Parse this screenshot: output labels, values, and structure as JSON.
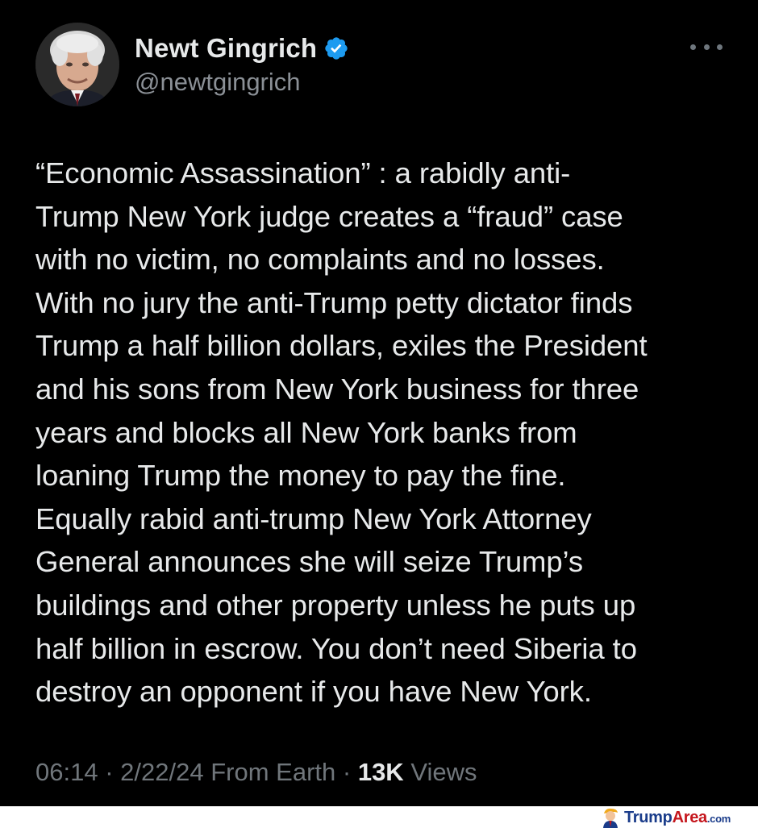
{
  "author": {
    "display_name": "Newt Gingrich",
    "handle": "@newtgingrich",
    "verified": true,
    "verified_icon": "verified-badge-icon",
    "avatar": "profile-photo"
  },
  "header": {
    "more_icon": "more-horizontal-icon"
  },
  "tweet": {
    "lines": [
      "“Economic Assassination” : a rabidly anti-",
      "Trump New York judge creates a “fraud” case",
      "with no victim, no complaints and no losses.",
      "With no jury the anti-Trump petty dictator finds",
      "Trump a half billion dollars, exiles the President",
      "and his sons from New York business for three",
      "years and blocks all New York banks from",
      "loaning Trump the money to pay the fine.",
      "Equally rabid anti-trump New York Attorney",
      "General announces she will seize Trump’s",
      "buildings and other property unless he puts up",
      "half billion in escrow. You don’t need Siberia to",
      "destroy an opponent if you have New York."
    ]
  },
  "meta": {
    "time": "06:14",
    "separator": "·",
    "date": "2/22/24",
    "source": "From Earth",
    "views_count": "13K",
    "views_label": "Views"
  },
  "watermark": {
    "brand_part1": "Trump",
    "brand_part2": "Area",
    "brand_suffix": ".com"
  },
  "colors": {
    "background": "#000000",
    "text_primary": "#e7e9ea",
    "text_secondary": "#8b9096",
    "verified_blue": "#1d9bf0",
    "brand_blue": "#1a3c8a",
    "brand_red": "#c5161d"
  }
}
